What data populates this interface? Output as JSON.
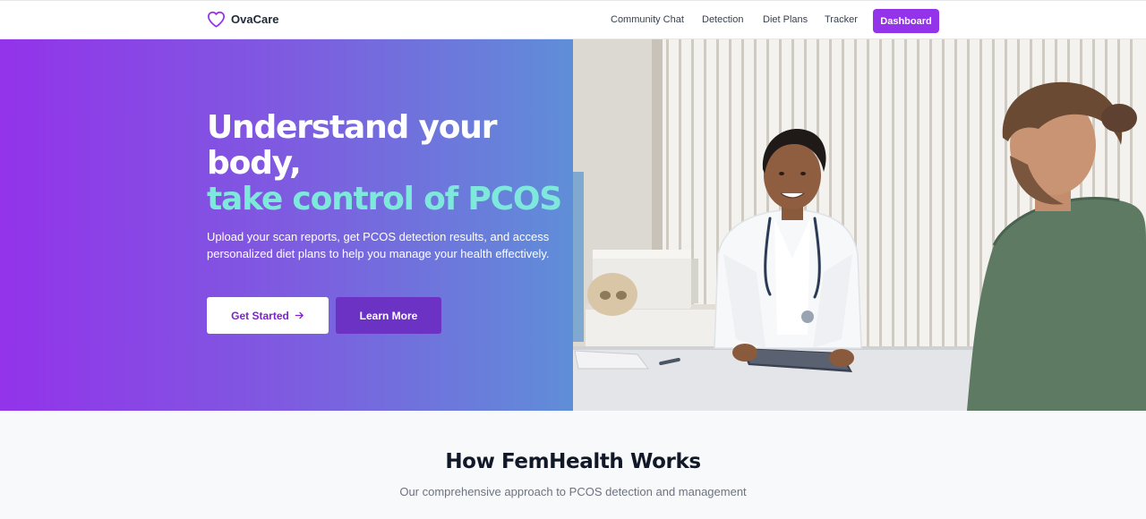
{
  "header": {
    "brand": "OvaCare",
    "nav": [
      "Community Chat",
      "Detection",
      "Diet Plans",
      "Tracker"
    ],
    "dashboard_label": "Dashboard"
  },
  "hero": {
    "headline_line1": "Understand your",
    "headline_line2": "body,",
    "headline_accent": "take control of PCOS",
    "description": "Upload your scan reports, get PCOS detection results, and access personalized diet plans to help you manage your health effectively.",
    "primary_button": "Get Started",
    "secondary_button": "Learn More"
  },
  "section": {
    "title": "How FemHealth Works",
    "subtitle": "Our comprehensive approach to PCOS detection and management"
  },
  "colors": {
    "brand_purple": "#9333ea",
    "accent_teal": "#7ee8dc",
    "gradient_end": "#5f8ed8"
  }
}
